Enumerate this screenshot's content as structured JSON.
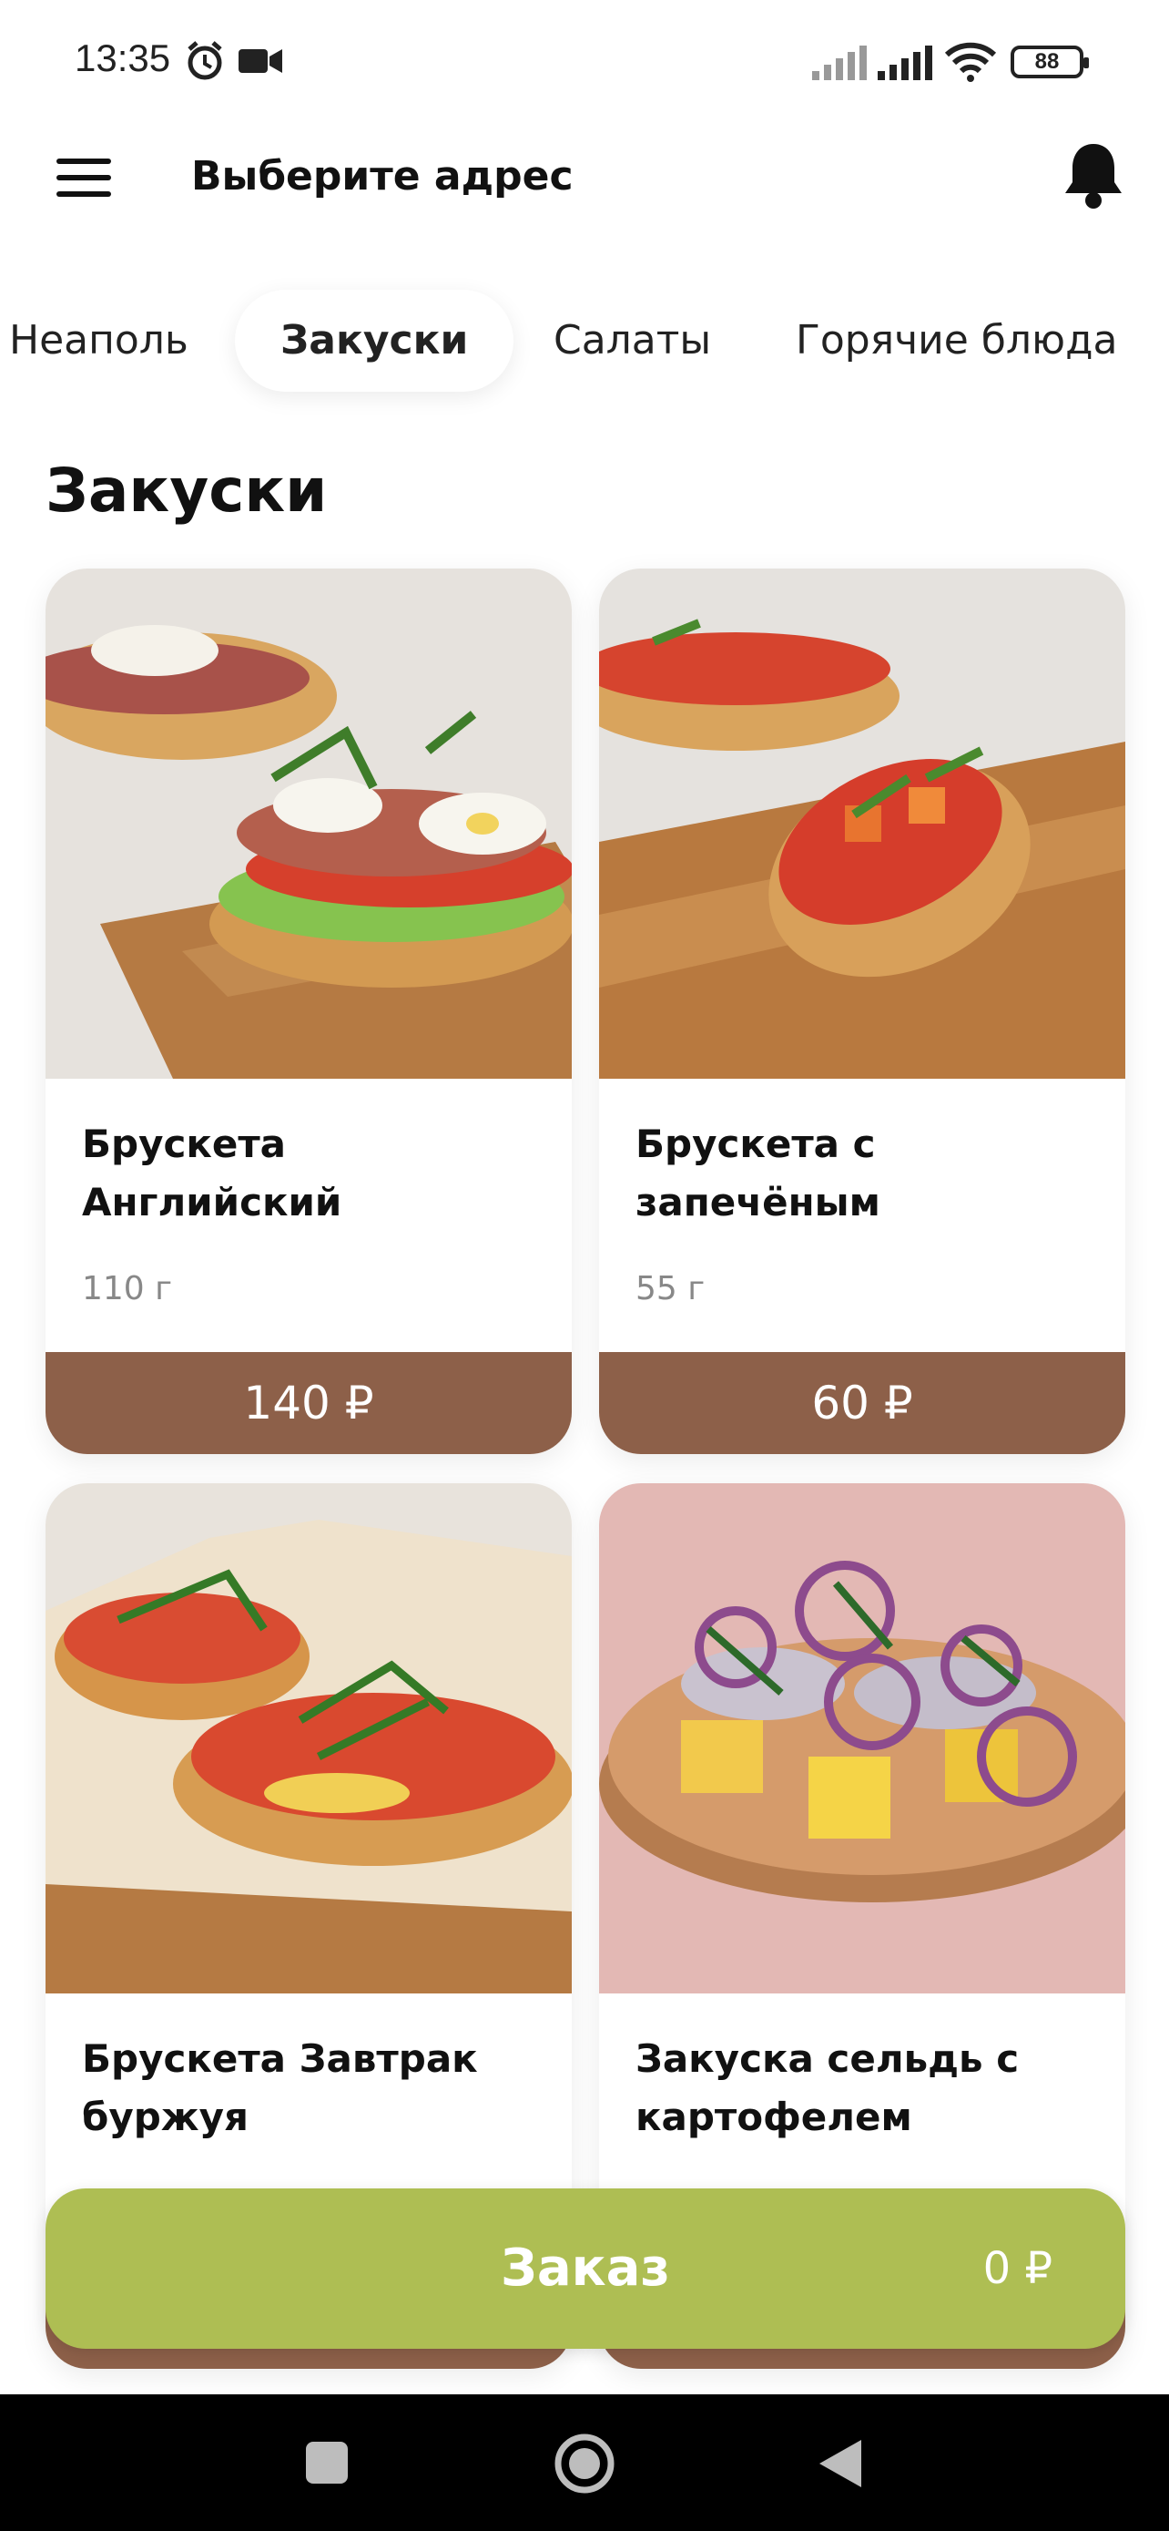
{
  "status_bar": {
    "time": "13:35",
    "battery": "88",
    "icons": [
      "alarm-icon",
      "video-camera-icon",
      "signal-icon",
      "signal-icon",
      "wifi-icon",
      "battery-icon"
    ]
  },
  "header": {
    "address_prompt": "Выберите адрес",
    "icons": [
      "menu-icon",
      "bell-icon"
    ]
  },
  "tabs": [
    {
      "label": "Неаполь",
      "active": false
    },
    {
      "label": "Закуски",
      "active": true
    },
    {
      "label": "Салаты",
      "active": false
    },
    {
      "label": "Горячие блюда",
      "active": false
    }
  ],
  "section": {
    "title": "Закуски"
  },
  "products": [
    {
      "name": "Брускета Английский",
      "weight": "110 г",
      "price": "140 ₽"
    },
    {
      "name": "Брускета с запечёным",
      "weight": "55 г",
      "price": "60 ₽"
    },
    {
      "name": "Брускета Завтрак буржуя",
      "weight": "",
      "price": ""
    },
    {
      "name": "Закуска сельдь с картофелем",
      "weight": "",
      "price": ""
    }
  ],
  "order": {
    "label": "Заказ",
    "total": "0 ₽"
  },
  "colors": {
    "price_bar": "#8d6049",
    "order_bar": "#aebe53",
    "nav_bar": "#000000"
  },
  "nav": {
    "icons": [
      "recent-apps-icon",
      "home-icon",
      "back-icon"
    ]
  }
}
